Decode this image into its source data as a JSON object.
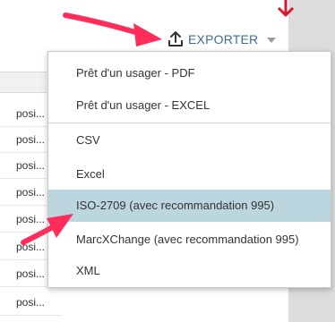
{
  "toolbar": {
    "export_label": "EXPORTER",
    "export_icon": "upload-icon",
    "caret_icon": "caret-down-icon"
  },
  "background_list": {
    "rows": [
      "posi...",
      "posi...",
      "posi...",
      "posi...",
      "posi...",
      "posi...",
      "posi...",
      "posi..."
    ]
  },
  "export_menu": {
    "items": [
      {
        "label": "Prêt d'un usager - PDF"
      },
      {
        "label": "Prêt d'un usager - EXCEL"
      },
      {
        "label": "CSV"
      },
      {
        "label": "Excel"
      },
      {
        "label": "ISO-2709 (avec recommandation 995)"
      },
      {
        "label": "MarcXChange (avec recommandation 995)"
      },
      {
        "label": "XML"
      }
    ],
    "active_item": "ISO-2709 (avec recommandation 995)"
  },
  "colors": {
    "accent_text": "#3a6f8f",
    "active_row": "#bcd6df",
    "annotation": "#ff2d5a",
    "red_arrow": "#e0142a"
  }
}
